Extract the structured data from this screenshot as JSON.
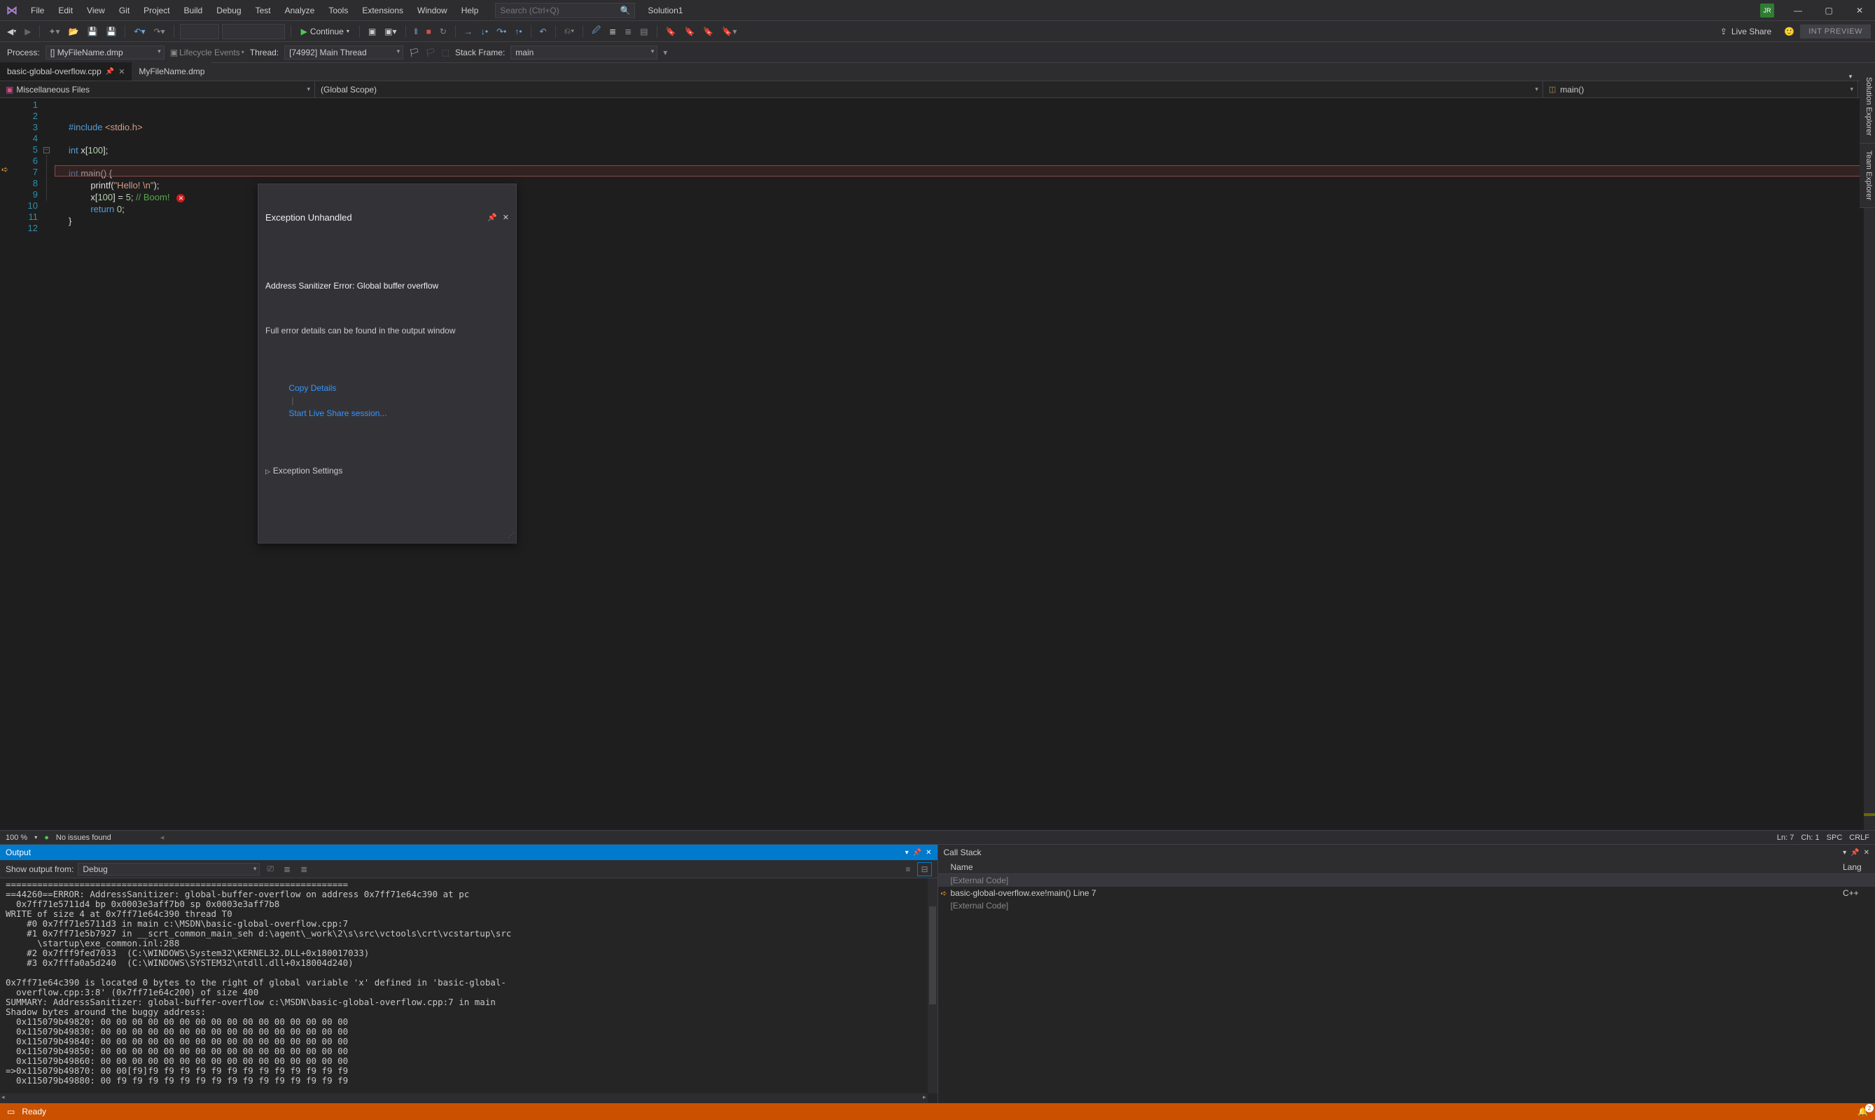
{
  "titlebar": {
    "menus": [
      "File",
      "Edit",
      "View",
      "Git",
      "Project",
      "Build",
      "Debug",
      "Test",
      "Analyze",
      "Tools",
      "Extensions",
      "Window",
      "Help"
    ],
    "search_placeholder": "Search (Ctrl+Q)",
    "solution": "Solution1",
    "user_initials": "JR"
  },
  "toolbar": {
    "continue_label": "Continue",
    "live_share": "Live Share",
    "preview_badge": "INT PREVIEW"
  },
  "debugbar": {
    "process_label": "Process:",
    "process_value": "[] MyFileName.dmp",
    "lifecycle_label": "Lifecycle Events",
    "thread_label": "Thread:",
    "thread_value": "[74992] Main Thread",
    "stackframe_label": "Stack Frame:",
    "stackframe_value": "main"
  },
  "tabs": {
    "items": [
      {
        "label": "basic-global-overflow.cpp",
        "active": true,
        "pinned": true
      },
      {
        "label": "MyFileName.dmp",
        "active": false,
        "pinned": false
      }
    ]
  },
  "nav": {
    "left": "Miscellaneous Files",
    "mid": "(Global Scope)",
    "right": "main()"
  },
  "code": {
    "lines": [
      1,
      2,
      3,
      4,
      5,
      6,
      7,
      8,
      9,
      10,
      11,
      12
    ],
    "l1_a": "#include ",
    "l1_b": "<stdio.h>",
    "l3_a": "int",
    "l3_b": " x[",
    "l3_c": "100",
    "l3_d": "];",
    "l5_a": "int",
    "l5_b": " main() {",
    "l6_a": "printf",
    "l6_b": "(",
    "l6_c": "\"Hello! \\n\"",
    "l6_d": ");",
    "l7_a": "x[",
    "l7_b": "100",
    "l7_c": "] = ",
    "l7_d": "5",
    "l7_e": "; ",
    "l7_f": "// Boom!",
    "l8_a": "return",
    "l8_b": " ",
    "l8_c": "0",
    "l8_d": ";",
    "l9_a": "}"
  },
  "exception": {
    "title": "Exception Unhandled",
    "message": "Address Sanitizer Error: Global buffer overflow",
    "note": "Full error details can be found in the output window",
    "copy": "Copy Details",
    "liveshare": "Start Live Share session...",
    "settings": "Exception Settings"
  },
  "editor_status": {
    "zoom": "100 %",
    "issues": "No issues found",
    "ln": "Ln: 7",
    "ch": "Ch: 1",
    "ind": "SPC",
    "eol": "CRLF"
  },
  "output": {
    "title": "Output",
    "from_label": "Show output from:",
    "from_value": "Debug",
    "text": "=================================================================\n==44260==ERROR: AddressSanitizer: global-buffer-overflow on address 0x7ff71e64c390 at pc \n  0x7ff71e5711d4 bp 0x0003e3aff7b0 sp 0x0003e3aff7b8\nWRITE of size 4 at 0x7ff71e64c390 thread T0\n    #0 0x7ff71e5711d3 in main c:\\MSDN\\basic-global-overflow.cpp:7\n    #1 0x7ff71e5b7927 in __scrt_common_main_seh d:\\agent\\_work\\2\\s\\src\\vctools\\crt\\vcstartup\\src\n      \\startup\\exe_common.inl:288\n    #2 0x7fff9fed7033  (C:\\WINDOWS\\System32\\KERNEL32.DLL+0x180017033)\n    #3 0x7fffa0a5d240  (C:\\WINDOWS\\SYSTEM32\\ntdll.dll+0x18004d240)\n\n0x7ff71e64c390 is located 0 bytes to the right of global variable 'x' defined in 'basic-global-\n  overflow.cpp:3:8' (0x7ff71e64c200) of size 400\nSUMMARY: AddressSanitizer: global-buffer-overflow c:\\MSDN\\basic-global-overflow.cpp:7 in main\nShadow bytes around the buggy address:\n  0x115079b49820: 00 00 00 00 00 00 00 00 00 00 00 00 00 00 00 00\n  0x115079b49830: 00 00 00 00 00 00 00 00 00 00 00 00 00 00 00 00\n  0x115079b49840: 00 00 00 00 00 00 00 00 00 00 00 00 00 00 00 00\n  0x115079b49850: 00 00 00 00 00 00 00 00 00 00 00 00 00 00 00 00\n  0x115079b49860: 00 00 00 00 00 00 00 00 00 00 00 00 00 00 00 00\n=>0x115079b49870: 00 00[f9]f9 f9 f9 f9 f9 f9 f9 f9 f9 f9 f9 f9 f9\n  0x115079b49880: 00 f9 f9 f9 f9 f9 f9 f9 f9 f9 f9 f9 f9 f9 f9 f9"
  },
  "callstack": {
    "title": "Call Stack",
    "col_name": "Name",
    "col_lang": "Lang",
    "rows": [
      {
        "name": "[External Code]",
        "lang": "",
        "ext": true,
        "sel": true,
        "arrow": false
      },
      {
        "name": "basic-global-overflow.exe!main() Line 7",
        "lang": "C++",
        "ext": false,
        "sel": false,
        "arrow": true
      },
      {
        "name": "[External Code]",
        "lang": "",
        "ext": true,
        "sel": false,
        "arrow": false
      }
    ]
  },
  "sidetabs": [
    "Solution Explorer",
    "Team Explorer"
  ],
  "statusbar": {
    "ready": "Ready",
    "bell_count": "2"
  }
}
